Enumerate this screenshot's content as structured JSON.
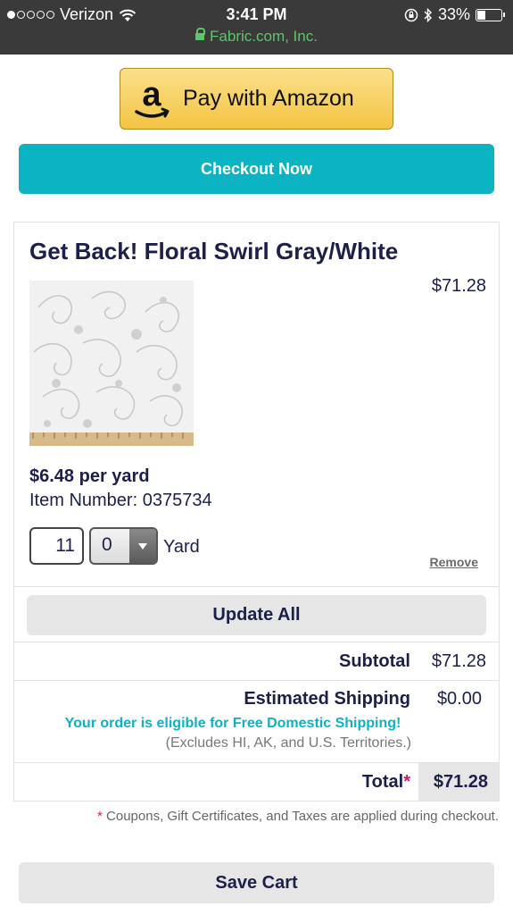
{
  "status_bar": {
    "carrier": "Verizon",
    "time": "3:41 PM",
    "battery": "33%",
    "battery_level": 0.33,
    "url": "Fabric.com, Inc."
  },
  "buttons": {
    "amazon": "Pay with Amazon",
    "checkout": "Checkout Now",
    "update": "Update All",
    "save": "Save Cart"
  },
  "item": {
    "title": "Get Back! Floral Swirl Gray/White",
    "line_price": "$71.28",
    "per_yard": "$6.48 per yard",
    "item_number": "Item Number: 0375734",
    "quantity": "11",
    "fraction": "0",
    "unit": "Yard",
    "remove": "Remove"
  },
  "totals": {
    "subtotal_label": "Subtotal",
    "subtotal_value": "$71.28",
    "shipping_label": "Estimated Shipping",
    "shipping_value": "$0.00",
    "free_shipping_note": "Your order is eligible for Free Domestic Shipping!",
    "excludes_note": "(Excludes HI, AK, and U.S. Territories.)",
    "total_label": "Total",
    "total_star": "*",
    "total_value": "$71.28"
  },
  "footnote": {
    "star": "*",
    "text": " Coupons, Gift Certificates, and Taxes are applied during checkout."
  },
  "colors": {
    "checkout": "#0bb3c3",
    "navy_text": "#1c1f4a",
    "url_green": "#5fc46a",
    "star_pink": "#cc1a6a"
  }
}
